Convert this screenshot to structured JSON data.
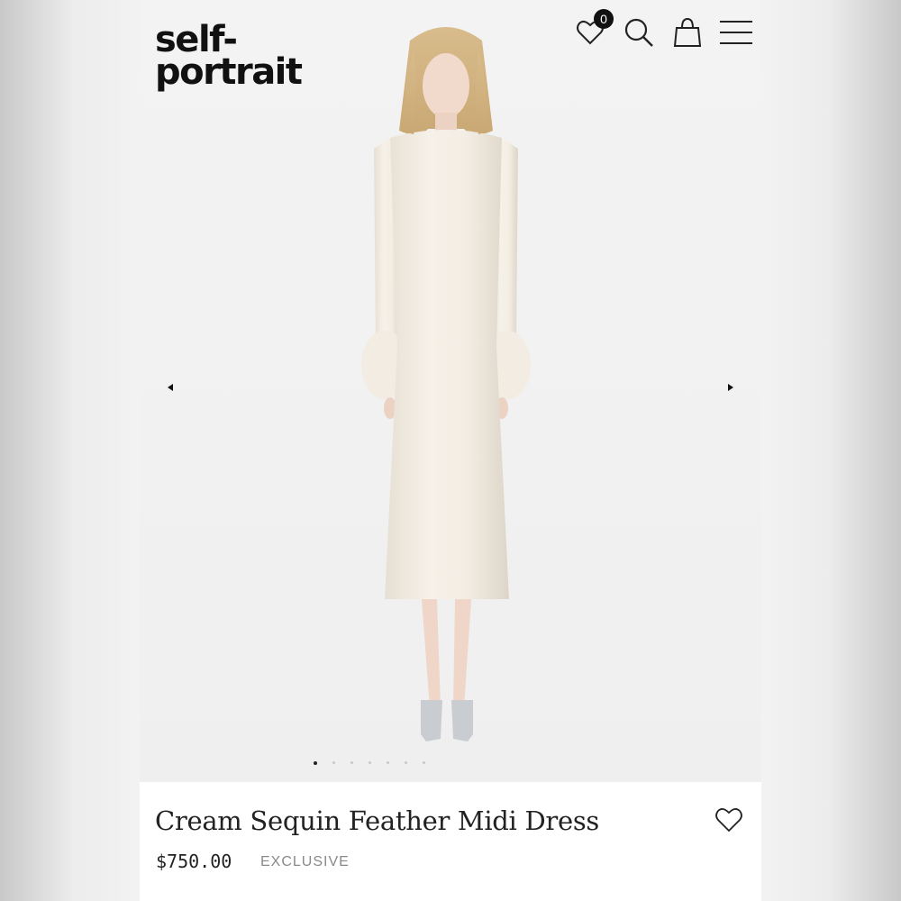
{
  "brand": {
    "logo_text": "self-\nportrait"
  },
  "header": {
    "wishlist_count": "0",
    "icons": [
      "heart-icon",
      "search-icon",
      "bag-icon",
      "menu-icon"
    ]
  },
  "gallery": {
    "image_count": 7,
    "active_index": 0,
    "prev_icon": "triangle-left-icon",
    "next_icon": "triangle-right-icon"
  },
  "product": {
    "name": "Cream Sequin Feather Midi Dress",
    "price": "$750.00",
    "tag": "EXCLUSIVE"
  },
  "colors": {
    "text": "#222222",
    "muted": "#8a8a8a",
    "dress": "#efe9df"
  }
}
